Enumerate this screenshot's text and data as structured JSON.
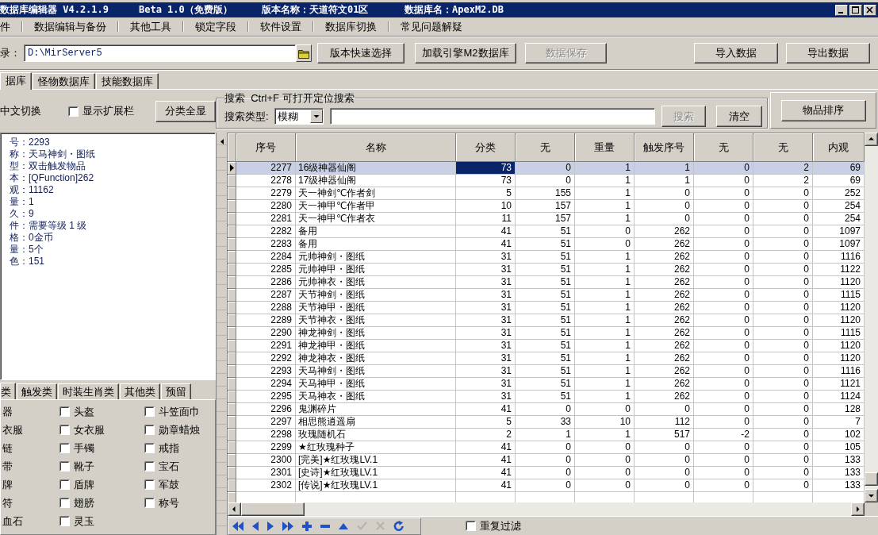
{
  "window": {
    "title_parts": [
      "数据库编辑器 V4.2.1.9",
      "Beta 1.0（免费版）",
      "版本名称：天道符文01区",
      "数据库名：ApexM2.DB"
    ]
  },
  "menu": [
    "件",
    "数据编辑与备份",
    "其他工具",
    "锁定字段",
    "软件设置",
    "数据库切换",
    "常见问题解疑"
  ],
  "toolbar": {
    "directory_label": "录：",
    "directory_value": "D:\\MirServer5",
    "buttons": [
      {
        "label": "版本快速选择",
        "disabled": false
      },
      {
        "label": "加载引擎M2数据库",
        "disabled": false
      },
      {
        "label": "数据保存",
        "disabled": true
      },
      {
        "label": "导入数据",
        "disabled": false
      },
      {
        "label": "导出数据",
        "disabled": false
      }
    ]
  },
  "database_tabs": [
    {
      "label": "据库",
      "selected": true
    },
    {
      "label": "怪物数据库",
      "selected": false
    },
    {
      "label": "技能数据库",
      "selected": false
    }
  ],
  "options": {
    "language_label": "中文切换",
    "show_extension": {
      "label": "显示扩展栏",
      "checked": false
    },
    "show_all_button": "分类全显"
  },
  "search": {
    "legend": "搜索  Ctrl+F 可打开定位搜索",
    "type_label": "搜索类型:",
    "type_value": "模糊",
    "buttons": [
      {
        "label": "搜索",
        "disabled": true
      },
      {
        "label": "清空",
        "disabled": false
      }
    ]
  },
  "sort_button": "物品排序",
  "item_info": [
    "号：2293",
    "称：天马神剑・图纸",
    "型：双击触发物品",
    "本：[QFunction]262",
    "观：11162",
    "量：1",
    "久：9",
    "件：需要等级 1 级",
    "格：0金币",
    "量：5个",
    "色：151"
  ],
  "category_tabs": [
    {
      "label": "类",
      "selected": true
    },
    {
      "label": "触发类",
      "selected": false
    },
    {
      "label": "时装生肖类",
      "selected": false
    },
    {
      "label": "其他类",
      "selected": false
    },
    {
      "label": "预留",
      "selected": false
    }
  ],
  "category_rows": [
    {
      "cut_label": "器",
      "checks": [
        {
          "label": "头盔",
          "checked": false
        },
        {
          "label": "斗笠面巾",
          "checked": false
        }
      ]
    },
    {
      "cut_label": "衣服",
      "checks": [
        {
          "label": "女衣服",
          "checked": false
        },
        {
          "label": "勋章蜡烛",
          "checked": false
        }
      ]
    },
    {
      "cut_label": "链",
      "checks": [
        {
          "label": "手镯",
          "checked": false
        },
        {
          "label": "戒指",
          "checked": false
        }
      ]
    },
    {
      "cut_label": "带",
      "checks": [
        {
          "label": "靴子",
          "checked": false
        },
        {
          "label": "宝石",
          "checked": false
        }
      ]
    },
    {
      "cut_label": "牌",
      "checks": [
        {
          "label": "盾牌",
          "checked": false
        },
        {
          "label": "军鼓",
          "checked": false
        }
      ]
    },
    {
      "cut_label": "符",
      "checks": [
        {
          "label": "翅膀",
          "checked": false
        },
        {
          "label": "称号",
          "checked": false
        }
      ]
    },
    {
      "cut_label": "血石",
      "checks": [
        {
          "label": "灵玉",
          "checked": false
        }
      ]
    }
  ],
  "table": {
    "columns": [
      {
        "label": "序号",
        "focused": false
      },
      {
        "label": "名称",
        "focused": false
      },
      {
        "label": "分类",
        "focused": true
      },
      {
        "label": "无",
        "focused": false
      },
      {
        "label": "重量",
        "focused": false
      },
      {
        "label": "触发序号",
        "focused": false
      },
      {
        "label": "无",
        "focused": false
      },
      {
        "label": "无",
        "focused": false
      },
      {
        "label": "内观",
        "focused": false
      }
    ],
    "rows": [
      {
        "selected": true,
        "cells": [
          "2277",
          "16级神器仙阁",
          "73",
          "0",
          "1",
          "1",
          "0",
          "2",
          "69"
        ]
      },
      {
        "selected": false,
        "cells": [
          "2278",
          "17级神器仙阁",
          "73",
          "0",
          "1",
          "1",
          "0",
          "2",
          "69"
        ]
      },
      {
        "selected": false,
        "cells": [
          "2279",
          "天一神剑℃作者剑",
          "5",
          "155",
          "1",
          "0",
          "0",
          "0",
          "252"
        ]
      },
      {
        "selected": false,
        "cells": [
          "2280",
          "天一神甲℃作者甲",
          "10",
          "157",
          "1",
          "0",
          "0",
          "0",
          "254"
        ]
      },
      {
        "selected": false,
        "cells": [
          "2281",
          "天一神甲℃作者衣",
          "11",
          "157",
          "1",
          "0",
          "0",
          "0",
          "254"
        ]
      },
      {
        "selected": false,
        "cells": [
          "2282",
          "备用",
          "41",
          "51",
          "0",
          "262",
          "0",
          "0",
          "1097"
        ]
      },
      {
        "selected": false,
        "cells": [
          "2283",
          "备用",
          "41",
          "51",
          "0",
          "262",
          "0",
          "0",
          "1097"
        ]
      },
      {
        "selected": false,
        "cells": [
          "2284",
          "元帅神剑・图纸",
          "31",
          "51",
          "1",
          "262",
          "0",
          "0",
          "1116"
        ]
      },
      {
        "selected": false,
        "cells": [
          "2285",
          "元帅神甲・图纸",
          "31",
          "51",
          "1",
          "262",
          "0",
          "0",
          "1122"
        ]
      },
      {
        "selected": false,
        "cells": [
          "2286",
          "元帅神衣・图纸",
          "31",
          "51",
          "1",
          "262",
          "0",
          "0",
          "1120"
        ]
      },
      {
        "selected": false,
        "cells": [
          "2287",
          "天节神剑・图纸",
          "31",
          "51",
          "1",
          "262",
          "0",
          "0",
          "1115"
        ]
      },
      {
        "selected": false,
        "cells": [
          "2288",
          "天节神甲・图纸",
          "31",
          "51",
          "1",
          "262",
          "0",
          "0",
          "1120"
        ]
      },
      {
        "selected": false,
        "cells": [
          "2289",
          "天节神衣・图纸",
          "31",
          "51",
          "1",
          "262",
          "0",
          "0",
          "1120"
        ]
      },
      {
        "selected": false,
        "cells": [
          "2290",
          "神龙神剑・图纸",
          "31",
          "51",
          "1",
          "262",
          "0",
          "0",
          "1115"
        ]
      },
      {
        "selected": false,
        "cells": [
          "2291",
          "神龙神甲・图纸",
          "31",
          "51",
          "1",
          "262",
          "0",
          "0",
          "1120"
        ]
      },
      {
        "selected": false,
        "cells": [
          "2292",
          "神龙神衣・图纸",
          "31",
          "51",
          "1",
          "262",
          "0",
          "0",
          "1120"
        ]
      },
      {
        "selected": false,
        "cells": [
          "2293",
          "天马神剑・图纸",
          "31",
          "51",
          "1",
          "262",
          "0",
          "0",
          "1116"
        ]
      },
      {
        "selected": false,
        "cells": [
          "2294",
          "天马神甲・图纸",
          "31",
          "51",
          "1",
          "262",
          "0",
          "0",
          "1121"
        ]
      },
      {
        "selected": false,
        "cells": [
          "2295",
          "天马神衣・图纸",
          "31",
          "51",
          "1",
          "262",
          "0",
          "0",
          "1124"
        ]
      },
      {
        "selected": false,
        "cells": [
          "2296",
          "鬼渊碎片",
          "41",
          "0",
          "0",
          "0",
          "0",
          "0",
          "128"
        ]
      },
      {
        "selected": false,
        "cells": [
          "2297",
          "相思熊逍遥扇",
          "5",
          "33",
          "10",
          "112",
          "0",
          "0",
          "7"
        ]
      },
      {
        "selected": false,
        "cells": [
          "2298",
          "玫瑰随机石",
          "2",
          "1",
          "1",
          "517",
          "-2",
          "0",
          "102"
        ]
      },
      {
        "selected": false,
        "cells": [
          "2299",
          "★红玫瑰种子",
          "41",
          "0",
          "0",
          "0",
          "0",
          "0",
          "105"
        ]
      },
      {
        "selected": false,
        "cells": [
          "2300",
          "[完美]★红玫瑰LV.1",
          "41",
          "0",
          "0",
          "0",
          "0",
          "0",
          "133"
        ]
      },
      {
        "selected": false,
        "cells": [
          "2301",
          "[史诗]★红玫瑰LV.1",
          "41",
          "0",
          "0",
          "0",
          "0",
          "0",
          "133"
        ]
      },
      {
        "selected": false,
        "cells": [
          "2302",
          "[传说]★红玫瑰LV.1",
          "41",
          "0",
          "0",
          "0",
          "0",
          "0",
          "133"
        ]
      }
    ]
  },
  "navigator": [
    {
      "kind": "first",
      "disabled": false
    },
    {
      "kind": "prior",
      "disabled": false
    },
    {
      "kind": "next",
      "disabled": false
    },
    {
      "kind": "last",
      "disabled": false
    },
    {
      "kind": "insert",
      "disabled": false
    },
    {
      "kind": "delete",
      "disabled": false
    },
    {
      "kind": "edit",
      "disabled": false
    },
    {
      "kind": "post",
      "disabled": true
    },
    {
      "kind": "cancel",
      "disabled": true
    },
    {
      "kind": "refresh",
      "disabled": false
    }
  ],
  "repeat_filter": {
    "label": "重复过滤",
    "checked": false
  }
}
